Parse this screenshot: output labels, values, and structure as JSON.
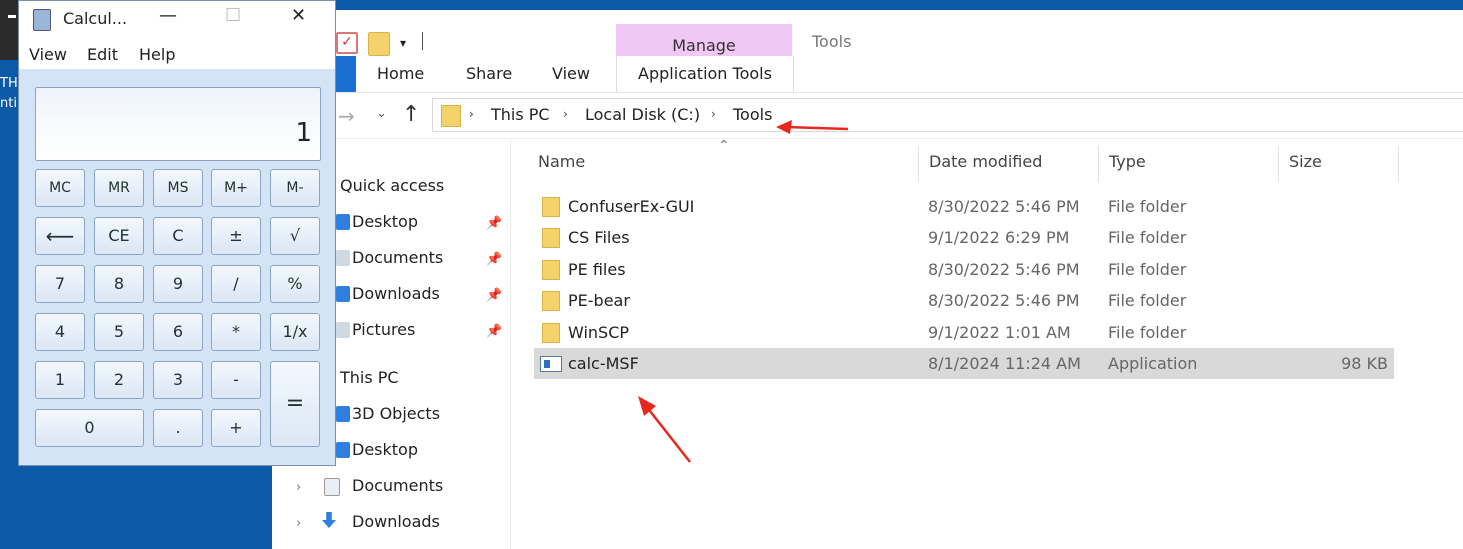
{
  "desktop": {
    "side_text": [
      "TH",
      "nti"
    ]
  },
  "explorer": {
    "ribbon": {
      "manage_tab": "Manage",
      "context_title": "Tools",
      "tabs": {
        "home": "Home",
        "share": "Share",
        "view": "View",
        "app_tools": "Application Tools"
      }
    },
    "address": {
      "crumbs": [
        "This PC",
        "Local Disk (C:)",
        "Tools"
      ]
    },
    "nav_pane": {
      "quick_access": "Quick access",
      "qa_items": [
        "Desktop",
        "Documents",
        "Downloads",
        "Pictures"
      ],
      "this_pc": "This PC",
      "pc_items": [
        "3D Objects",
        "Desktop",
        "Documents",
        "Downloads"
      ]
    },
    "columns": {
      "name": "Name",
      "date": "Date modified",
      "type": "Type",
      "size": "Size"
    },
    "files": [
      {
        "name": "ConfuserEx-GUI",
        "date": "8/30/2022 5:46 PM",
        "type": "File folder",
        "size": ""
      },
      {
        "name": "CS Files",
        "date": "9/1/2022 6:29 PM",
        "type": "File folder",
        "size": ""
      },
      {
        "name": "PE files",
        "date": "8/30/2022 5:46 PM",
        "type": "File folder",
        "size": ""
      },
      {
        "name": "PE-bear",
        "date": "8/30/2022 5:46 PM",
        "type": "File folder",
        "size": ""
      },
      {
        "name": "WinSCP",
        "date": "9/1/2022 1:01 AM",
        "type": "File folder",
        "size": ""
      },
      {
        "name": "calc-MSF",
        "date": "8/1/2024 11:24 AM",
        "type": "Application",
        "size": "98 KB"
      }
    ]
  },
  "calculator": {
    "title": "Calcul...",
    "menu": {
      "view": "View",
      "edit": "Edit",
      "help": "Help"
    },
    "display": "1",
    "buttons": {
      "mc": "MC",
      "mr": "MR",
      "ms": "MS",
      "mplus": "M+",
      "mminus": "M-",
      "back": "⟵",
      "ce": "CE",
      "c": "C",
      "plusminus": "±",
      "sqrt": "√",
      "seven": "7",
      "eight": "8",
      "nine": "9",
      "divide": "/",
      "percent": "%",
      "four": "4",
      "five": "5",
      "six": "6",
      "multiply": "*",
      "reciprocal": "1/x",
      "one": "1",
      "two": "2",
      "three": "3",
      "minus": "-",
      "equals": "=",
      "zero": "0",
      "dot": ".",
      "plus": "+"
    }
  },
  "colors": {
    "desktop": "#0b5aa8",
    "manage_tab": "#f0c8f3",
    "selection": "#d9d9d9",
    "annotation": "#e8281e"
  }
}
